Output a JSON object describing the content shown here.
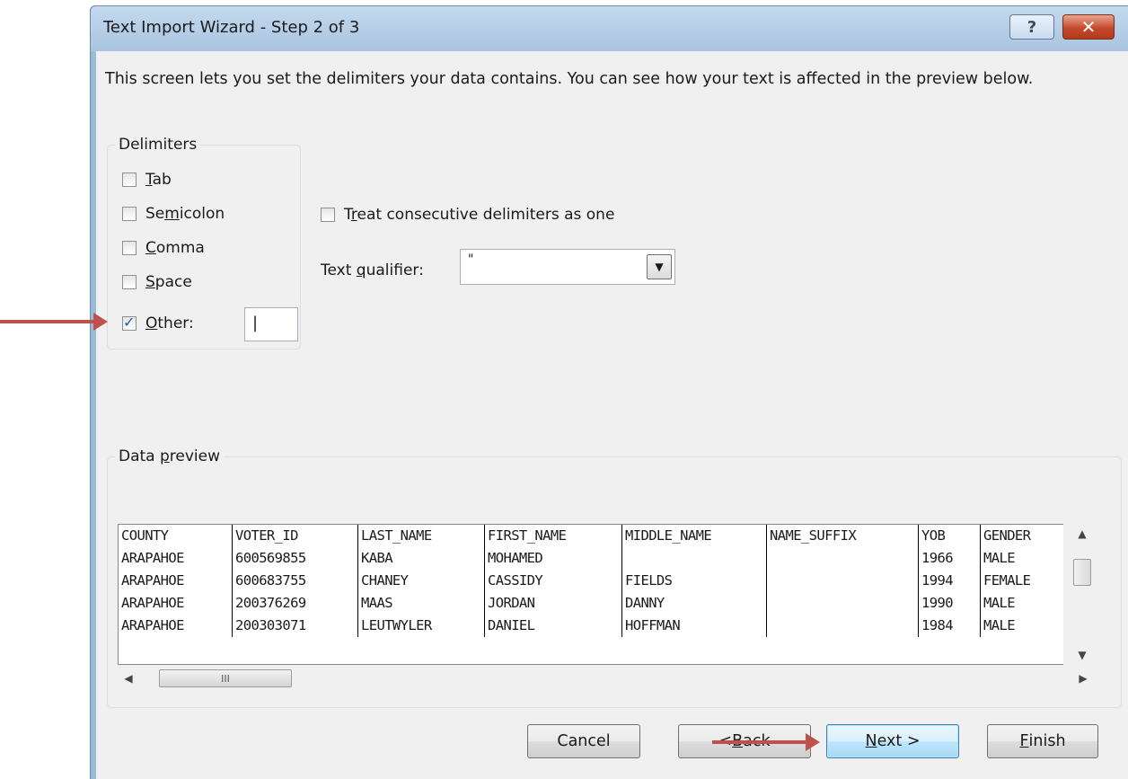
{
  "window": {
    "title": "Text Import Wizard - Step 2 of 3",
    "help_label": "?",
    "close_label": "✕"
  },
  "intro_text": "This screen lets you set the delimiters your data contains.  You can see how your text is affected in the preview below.",
  "delimiters": {
    "group_label": "Delimiters",
    "options": [
      {
        "pre": "",
        "key": "T",
        "post": "ab",
        "checked": false
      },
      {
        "pre": "Se",
        "key": "m",
        "post": "icolon",
        "checked": false
      },
      {
        "pre": "",
        "key": "C",
        "post": "omma",
        "checked": false
      },
      {
        "pre": "",
        "key": "S",
        "post": "pace",
        "checked": false
      },
      {
        "pre": "",
        "key": "O",
        "post": "ther:",
        "checked": true
      }
    ],
    "other_value": "|"
  },
  "treat_consecutive": {
    "pre": "T",
    "key": "r",
    "post": "eat consecutive delimiters as one",
    "checked": false
  },
  "text_qualifier": {
    "pre": "Text ",
    "key": "q",
    "post": "ualifier:",
    "value": "\""
  },
  "preview": {
    "group_label_pre": "Data ",
    "group_label_key": "p",
    "group_label_post": "review",
    "rows": [
      [
        "COUNTY",
        "VOTER_ID",
        "LAST_NAME",
        "FIRST_NAME",
        "MIDDLE_NAME",
        "NAME_SUFFIX",
        "YOB",
        "GENDER"
      ],
      [
        "ARAPAHOE",
        "600569855",
        "KABA",
        "MOHAMED",
        "",
        "",
        "1966",
        "MALE"
      ],
      [
        "ARAPAHOE",
        "600683755",
        "CHANEY",
        "CASSIDY",
        "FIELDS",
        "",
        "1994",
        "FEMALE"
      ],
      [
        "ARAPAHOE",
        "200376269",
        "MAAS",
        "JORDAN",
        "DANNY",
        "",
        "1990",
        "MALE"
      ],
      [
        "ARAPAHOE",
        "200303071",
        "LEUTWYLER",
        "DANIEL",
        "HOFFMAN",
        "",
        "1984",
        "MALE"
      ]
    ],
    "hscroll_grip": "III"
  },
  "buttons": {
    "cancel": "Cancel",
    "back_pre": "< ",
    "back_key": "B",
    "back_post": "ack",
    "next_key": "N",
    "next_post": "ext >",
    "finish_key": "F",
    "finish_post": "inish"
  },
  "colors": {
    "annotation_arrow": "#c0504d",
    "titlebar": "#a9c4e0",
    "dialog_bg": "#f0f0f0"
  }
}
